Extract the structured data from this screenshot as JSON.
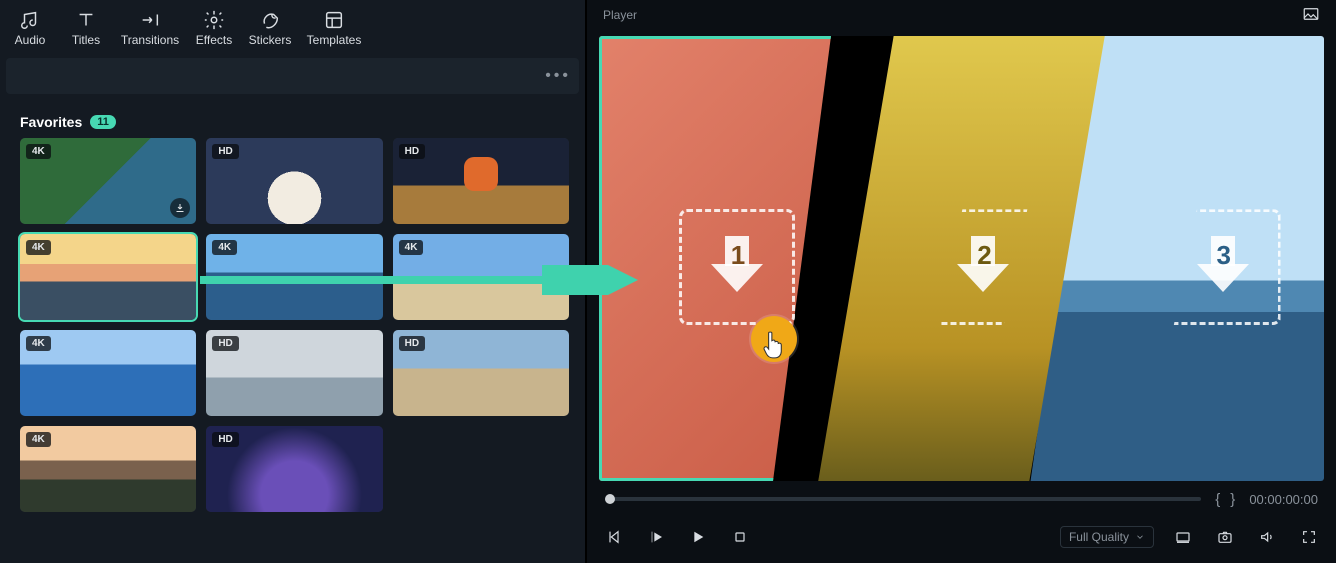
{
  "toolbar": {
    "items": [
      {
        "label": "Audio",
        "icon": "audio"
      },
      {
        "label": "Titles",
        "icon": "titles"
      },
      {
        "label": "Transitions",
        "icon": "transitions"
      },
      {
        "label": "Effects",
        "icon": "effects"
      },
      {
        "label": "Stickers",
        "icon": "stickers"
      },
      {
        "label": "Templates",
        "icon": "templates"
      }
    ],
    "more": "•••"
  },
  "favorites": {
    "title": "Favorites",
    "count": "11",
    "items": [
      {
        "res": "4K",
        "download": true,
        "art": "forest-river"
      },
      {
        "res": "HD",
        "download": false,
        "art": "snow-village"
      },
      {
        "res": "HD",
        "download": false,
        "art": "desert-robot"
      },
      {
        "res": "4K",
        "download": false,
        "art": "sunset",
        "selected": true
      },
      {
        "res": "4K",
        "download": false,
        "art": "sky-sea"
      },
      {
        "res": "4K",
        "download": false,
        "art": "beach"
      },
      {
        "res": "4K",
        "download": false,
        "art": "blue-surf"
      },
      {
        "res": "HD",
        "download": false,
        "art": "winter-lake"
      },
      {
        "res": "HD",
        "download": false,
        "art": "city-beach"
      },
      {
        "res": "4K",
        "download": false,
        "art": "plain-sunset"
      },
      {
        "res": "HD",
        "download": false,
        "art": "fantasy"
      }
    ]
  },
  "player": {
    "title": "Player",
    "slots": [
      {
        "num": "1"
      },
      {
        "num": "2"
      },
      {
        "num": "3"
      }
    ],
    "brace_open": "{",
    "brace_close": "}",
    "timecode": "00:00:00:00",
    "quality_label": "Full Quality"
  }
}
